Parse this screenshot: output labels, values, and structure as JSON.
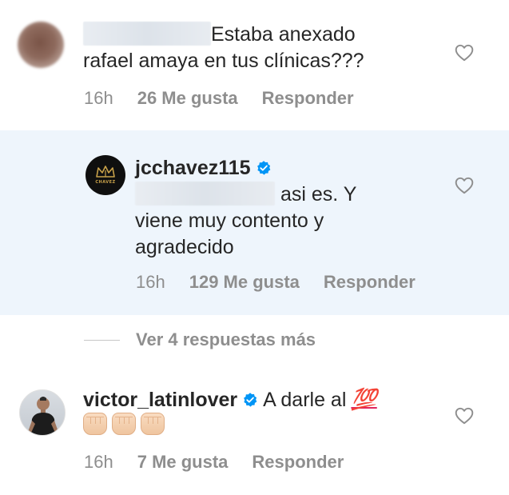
{
  "comments": [
    {
      "username": "",
      "text_line1": "Estaba anexado",
      "text_line2": "rafael amaya en tus clínicas???",
      "time": "16h",
      "likes": "26 Me gusta",
      "reply": "Responder"
    },
    {
      "username": "jcchavez115",
      "verified": true,
      "avatar_brand": "CHAVEZ",
      "text_line1": "asi es. Y",
      "text_line2": "viene muy contento y",
      "text_line3": "agradecido",
      "time": "16h",
      "likes": "129 Me gusta",
      "reply": "Responder"
    },
    {
      "username": "victor_latinlover",
      "verified": true,
      "text": "A darle al",
      "emoji": "💯",
      "fist_count": 3,
      "time": "16h",
      "likes": "7 Me gusta",
      "reply": "Responder"
    }
  ],
  "more_replies": "Ver 4 respuestas más",
  "colors": {
    "highlight": "#eef5fc",
    "verified": "#0095f6",
    "muted": "#8e8e8e",
    "text": "#262626"
  },
  "icons": [
    "heart-outline-icon",
    "verified-badge-icon",
    "hundred-points-emoji",
    "fist-emoji"
  ]
}
